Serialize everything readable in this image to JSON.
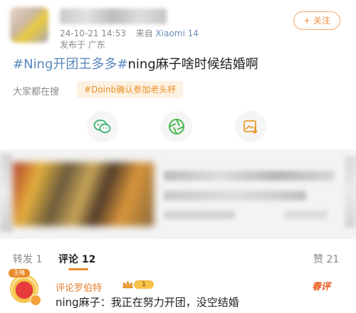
{
  "header": {
    "timestamp": "24-10-21 14:53",
    "source_prefix": "来自",
    "source_device": "Xiaomi 14",
    "location": "发布于 广东",
    "follow_label": "+ 关注"
  },
  "post": {
    "tag1": "#Ning开团王多多#",
    "body": "ning麻子啥时候结婚啊"
  },
  "search": {
    "label": "大家都在搜",
    "chip": "#Doinb确认参加老头杯"
  },
  "share_icons": [
    "wechat-icon",
    "moments-icon",
    "image-save-icon"
  ],
  "tabs": {
    "repost": "转发 1",
    "comment": "评论 12",
    "like": "赞 21"
  },
  "comment": {
    "username": "评论罗伯特",
    "level": "1",
    "badge": "王晴",
    "text": "ning麻子：我正在努力开团，没空结婚",
    "logo": "春评"
  },
  "colors": {
    "accent": "#f08a2a",
    "tag_blue": "#5a88bf",
    "chip_bg": "#fdf1e2"
  }
}
